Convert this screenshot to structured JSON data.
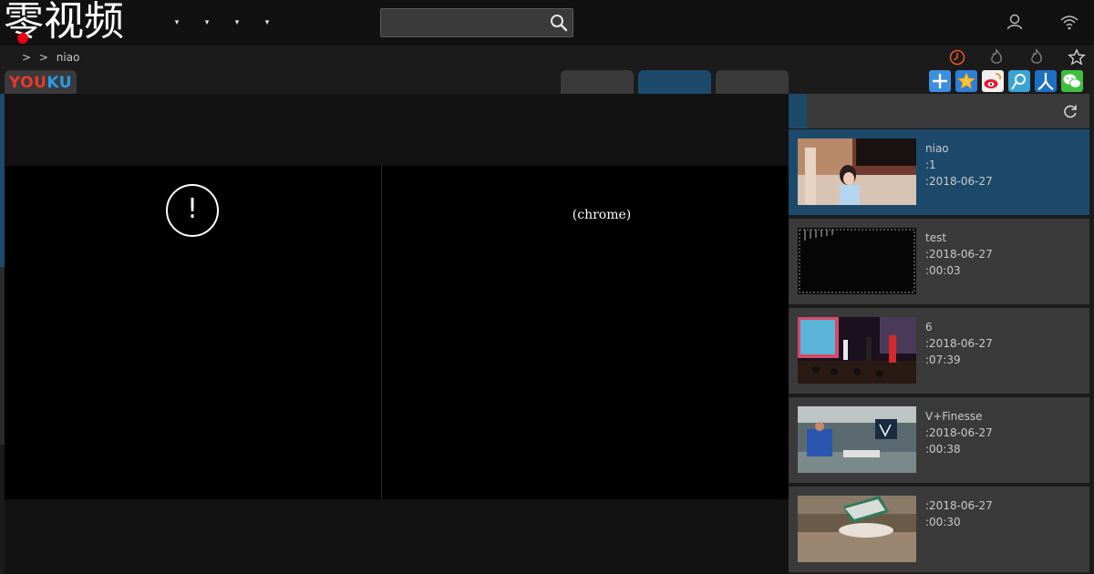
{
  "header": {
    "logo_text": "零视频",
    "nav_arrows": [
      "▾",
      "▾",
      "▾",
      "▾"
    ],
    "search_value": "",
    "search_placeholder": ""
  },
  "breadcrumb": {
    "sep1": ">",
    "sep2": ">",
    "current": "niao"
  },
  "badge": {
    "you": "YOU",
    "ku": "KU"
  },
  "player": {
    "alert_glyph": "!",
    "message": "(chrome)"
  },
  "playlist": [
    {
      "title": "niao",
      "line2": ":1",
      "line3": ":2018-06-27",
      "active": true
    },
    {
      "title": "test",
      "line2": ":2018-06-27",
      "line3": ":00:03",
      "active": false
    },
    {
      "title": "6",
      "line2": ":2018-06-27",
      "line3": ":07:39",
      "active": false
    },
    {
      "title": "V+Finesse",
      "line2": ":2018-06-27",
      "line3": ":00:38",
      "active": false
    },
    {
      "title": "",
      "line2": ":2018-06-27",
      "line3": ":00:30",
      "active": false
    }
  ],
  "colors": {
    "accent": "#1d4a6b",
    "brand_red": "#e60012",
    "history_icon": "#e8562a"
  },
  "icons": [
    "search-icon",
    "user-icon",
    "wifi-icon",
    "history-icon",
    "hot-icon",
    "hot-icon",
    "star-icon",
    "refresh-icon",
    "share-add-icon",
    "share-qzone-icon",
    "share-weibo-icon",
    "share-tencent-icon",
    "share-renren-icon",
    "share-wechat-icon"
  ]
}
